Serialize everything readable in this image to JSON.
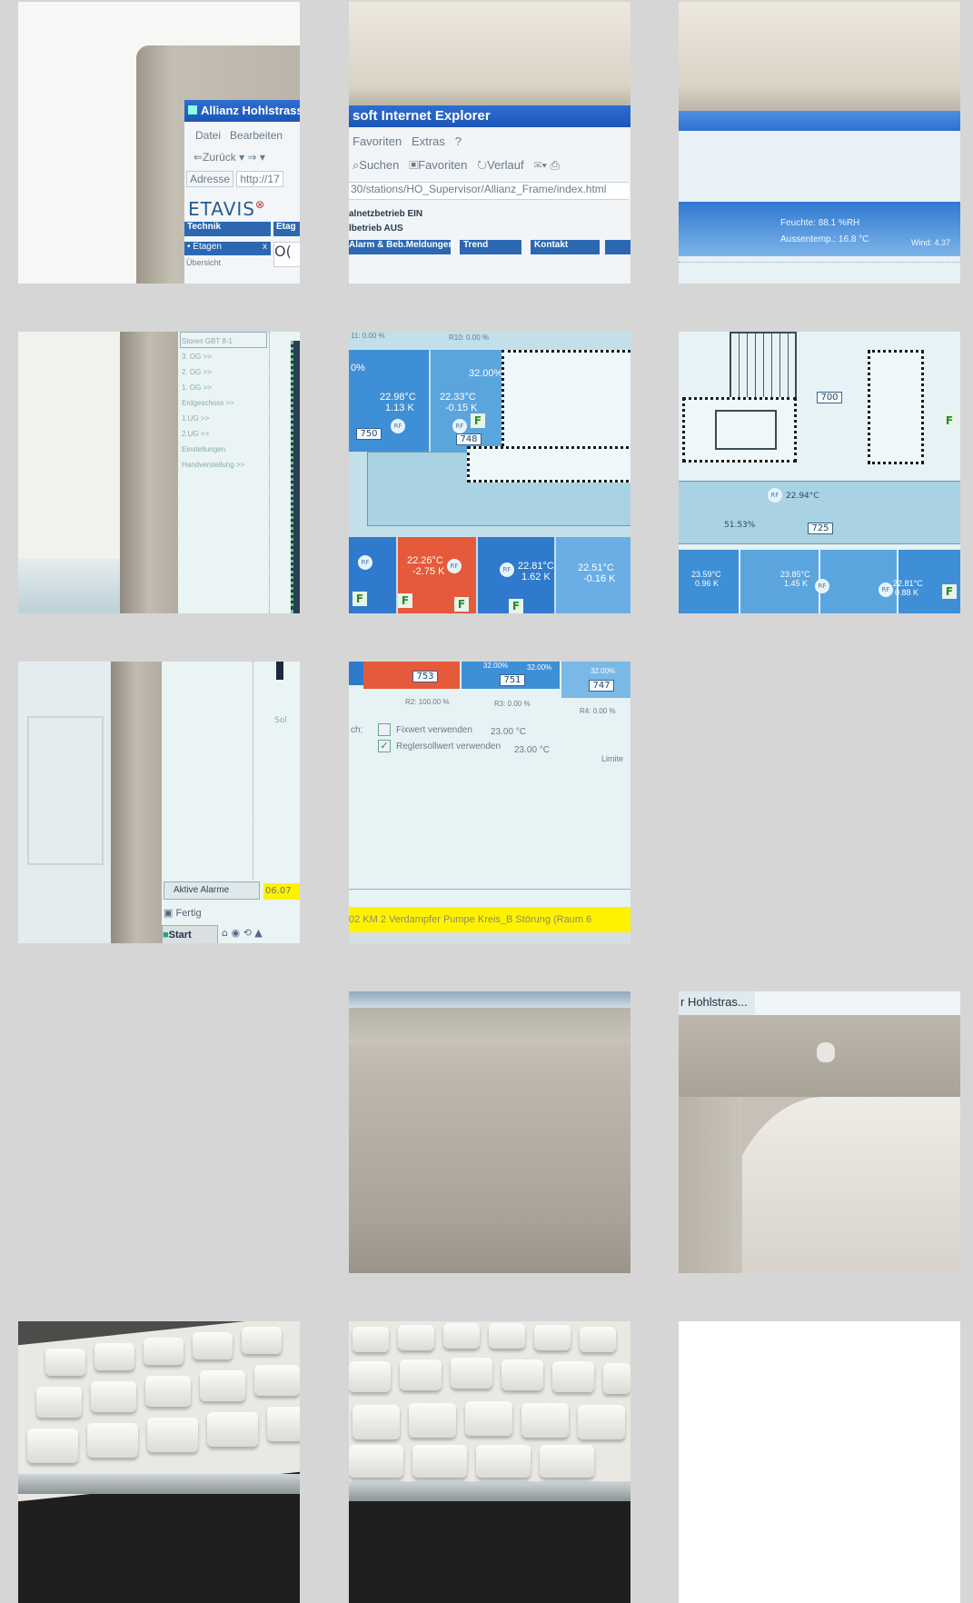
{
  "ie": {
    "title_left": "Allianz Hohlstrass",
    "title_right": "soft Internet Explorer",
    "menu": {
      "datei": "Datei",
      "bearbeiten": "Bearbeiten",
      "favoriten": "Favoriten",
      "extras": "Extras",
      "help": "?"
    },
    "toolbar": {
      "zurueck": "Zurück",
      "suchen": "Suchen",
      "favoriten": "Favoriten",
      "verlauf": "Verlauf"
    },
    "address_label": "Adresse",
    "address_left": "http://17",
    "address_right": "30/stations/HO_Supervisor/Allianz_Frame/index.html"
  },
  "etavis": {
    "logo": "ETAVIS",
    "tabs": {
      "technik": "Technik",
      "etage": "Etag",
      "alarm": "Alarm & Beb.Meldungen",
      "trend": "Trend",
      "kontakt": "Kontakt"
    },
    "status1": "alnetzbetrieb EIN",
    "status2": "lbetrieb AUS",
    "etagen": "Etagen",
    "uebersicht": "Übersicht",
    "feuchte": "Feuchte: 88.1 %RH",
    "aussentemp": "Aussentemp.: 16.8 °C",
    "wind": "Wind: 4.37",
    "nav": [
      "Storen GBT 8-1",
      "3. OG >>",
      "2. OG >>",
      "1. OG >>",
      "Erdgeschoss >>",
      "1.UG >>",
      "2.UG >>",
      "Einstellungen",
      "Handverstellung >>"
    ]
  },
  "floorplan": {
    "r11": "11: 0.00 %",
    "r10": "R10: 0.00 %",
    "pct_left": "0%",
    "pct_32a": "32.00%",
    "temp_a": "22.98°C",
    "temp_a2": "1.13 K",
    "temp_b": "22.33°C",
    "temp_b2": "-0.15 K",
    "room_750": "750",
    "room_748": "748",
    "room_700": "700",
    "room_725": "725",
    "hum_51": "51.53%",
    "temp_c": "22.94°C",
    "red_temp": "22.26°C",
    "red_delta": "-2.75 K",
    "temp_d": "22.81°C",
    "temp_d2": "1.62 K",
    "temp_e": "22.51°C",
    "temp_e2": "-0.16 K",
    "temp_f": "23.59°C",
    "temp_f2": "0.96 K",
    "temp_g": "23.85°C",
    "temp_g2": "1.45 K",
    "temp_h": "22.81°C",
    "temp_h2": "0.88 K",
    "rf": "RF",
    "f": "F",
    "room_753": "753",
    "room_751": "751",
    "room_747": "747",
    "pct_32b": "32.00%",
    "pct_32c": "32.00%",
    "pct_32d": "32.00%",
    "r2": "R2: 100.00 %",
    "r3": "R3: 0.00 %",
    "r4": "R4: 0.00 %",
    "ch": "ch:",
    "fixwert": "Fixwert verwenden",
    "fixwert_val": "23.00 °C",
    "regler": "Reglersollwert verwenden",
    "regler_val": "23.00 °C",
    "limite": "Limite",
    "so": "Sol"
  },
  "statusbar": {
    "aktive_alarme": "Aktive Alarme",
    "alarm_num": "06.07",
    "alarm_text": "02   KM 2 Verdampfer Pumpe Kreis_B Störung (Raum 6",
    "fertig": "Fertig",
    "start": "Start",
    "taskbar_item": "r Hohlstras..."
  },
  "colors": {
    "background": "#d6d6d6",
    "bezel": "#b8b2a4",
    "screen": "#dfeff4",
    "ie_blue": "#1f5fc4",
    "room_blue": "#3f8fd6",
    "room_red": "#e55a3a",
    "alarm_yellow": "#fff200"
  }
}
